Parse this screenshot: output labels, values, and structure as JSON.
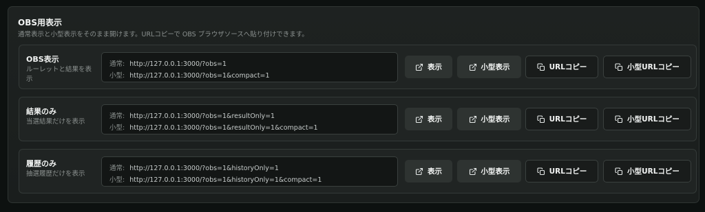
{
  "panel": {
    "title": "OBS用表示",
    "description": "通常表示と小型表示をそのまま開けます。URLコピーで OBS ブラウザソースへ貼り付けできます。"
  },
  "rows": [
    {
      "title": "OBS表示",
      "description": "ルーレットと結果を表示",
      "normal_label": "通常:",
      "normal_url": "http://127.0.0.1:3000/?obs=1",
      "compact_label": "小型:",
      "compact_url": "http://127.0.0.1:3000/?obs=1&compact=1",
      "open_label": "表示",
      "open_compact_label": "小型表示",
      "copy_label": "URLコピー",
      "copy_compact_label": "小型URLコピー"
    },
    {
      "title": "結果のみ",
      "description": "当選結果だけを表示",
      "normal_label": "通常:",
      "normal_url": "http://127.0.0.1:3000/?obs=1&resultOnly=1",
      "compact_label": "小型:",
      "compact_url": "http://127.0.0.1:3000/?obs=1&resultOnly=1&compact=1",
      "open_label": "表示",
      "open_compact_label": "小型表示",
      "copy_label": "URLコピー",
      "copy_compact_label": "小型URLコピー"
    },
    {
      "title": "履歴のみ",
      "description": "抽選履歴だけを表示",
      "normal_label": "通常:",
      "normal_url": "http://127.0.0.1:3000/?obs=1&historyOnly=1",
      "compact_label": "小型:",
      "compact_url": "http://127.0.0.1:3000/?obs=1&historyOnly=1&compact=1",
      "open_label": "表示",
      "open_compact_label": "小型表示",
      "copy_label": "URLコピー",
      "copy_compact_label": "小型URLコピー"
    }
  ],
  "icons": {
    "open": "external-link-icon",
    "copy": "copy-icon"
  },
  "colors": {
    "background": "#0d1110",
    "panel": "#1e2221",
    "row": "#202423",
    "text": "#f2f4f3",
    "muted": "#8b918f"
  }
}
